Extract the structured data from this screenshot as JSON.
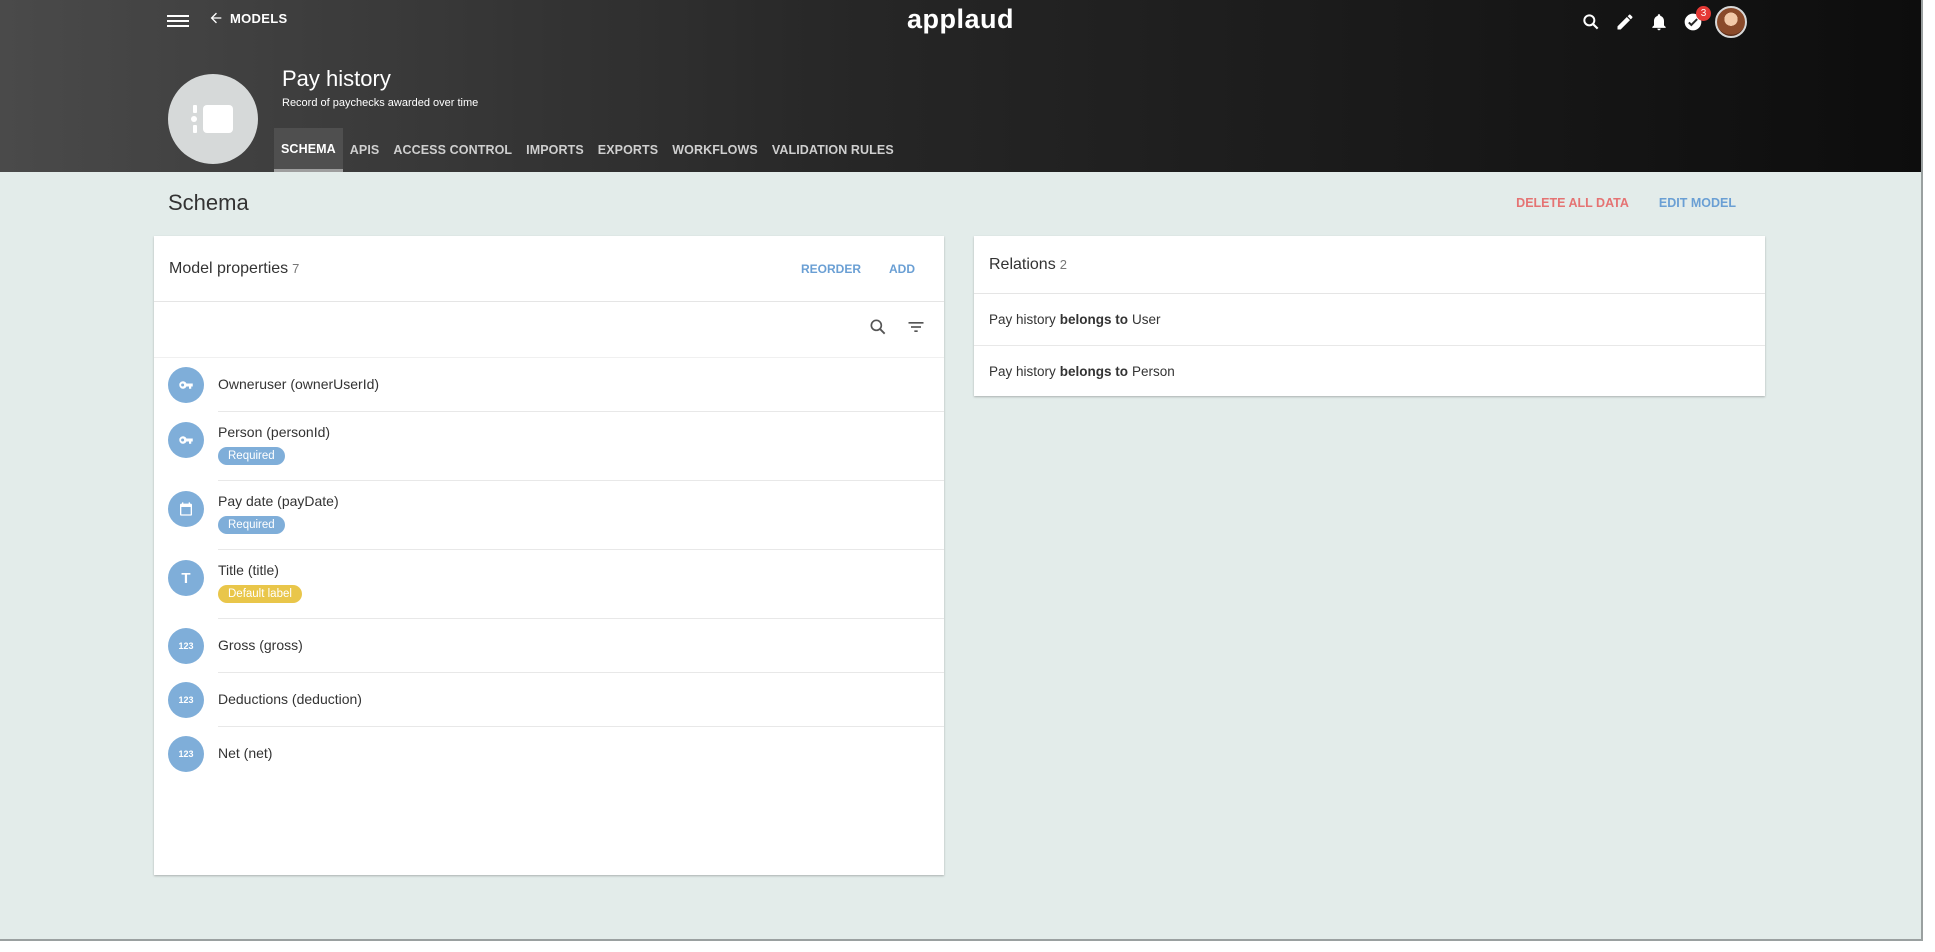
{
  "header": {
    "back_label": "MODELS",
    "brand": "applaud",
    "notification_count": "3"
  },
  "model": {
    "title": "Pay history",
    "description": "Record of paychecks  awarded over time"
  },
  "tabs": [
    {
      "label": "SCHEMA",
      "active": true
    },
    {
      "label": "APIS"
    },
    {
      "label": "ACCESS CONTROL"
    },
    {
      "label": "IMPORTS"
    },
    {
      "label": "EXPORTS"
    },
    {
      "label": "WORKFLOWS"
    },
    {
      "label": "VALIDATION RULES"
    }
  ],
  "page": {
    "title": "Schema",
    "delete_label": "DELETE ALL DATA",
    "edit_label": "EDIT MODEL"
  },
  "properties_card": {
    "title": "Model properties",
    "count": "7",
    "reorder_label": "REORDER",
    "add_label": "ADD",
    "items": [
      {
        "name": "Owneruser (ownerUserId)",
        "icon": "key-icon"
      },
      {
        "name": "Person (personId)",
        "icon": "key-icon",
        "badge": "Required"
      },
      {
        "name": "Pay date (payDate)",
        "icon": "calendar-icon",
        "badge": "Required"
      },
      {
        "name": "Title (title)",
        "icon": "text-type-icon",
        "icon_text": "T",
        "badge": "Default label"
      },
      {
        "name": "Gross (gross)",
        "icon": "number-type-icon",
        "icon_text": "123"
      },
      {
        "name": "Deductions (deduction)",
        "icon": "number-type-icon",
        "icon_text": "123"
      },
      {
        "name": "Net (net)",
        "icon": "number-type-icon",
        "icon_text": "123"
      }
    ]
  },
  "relations_card": {
    "title": "Relations",
    "count": "2",
    "items": [
      {
        "subject": "Pay history",
        "verb": "belongs to",
        "target": "User"
      },
      {
        "subject": "Pay history",
        "verb": "belongs to",
        "target": "Person"
      }
    ]
  },
  "colors": {
    "accent_blue": "#7faed9",
    "danger_red": "#e57373",
    "default_badge_yellow": "#e9c64a",
    "page_background": "#e3ecea"
  }
}
